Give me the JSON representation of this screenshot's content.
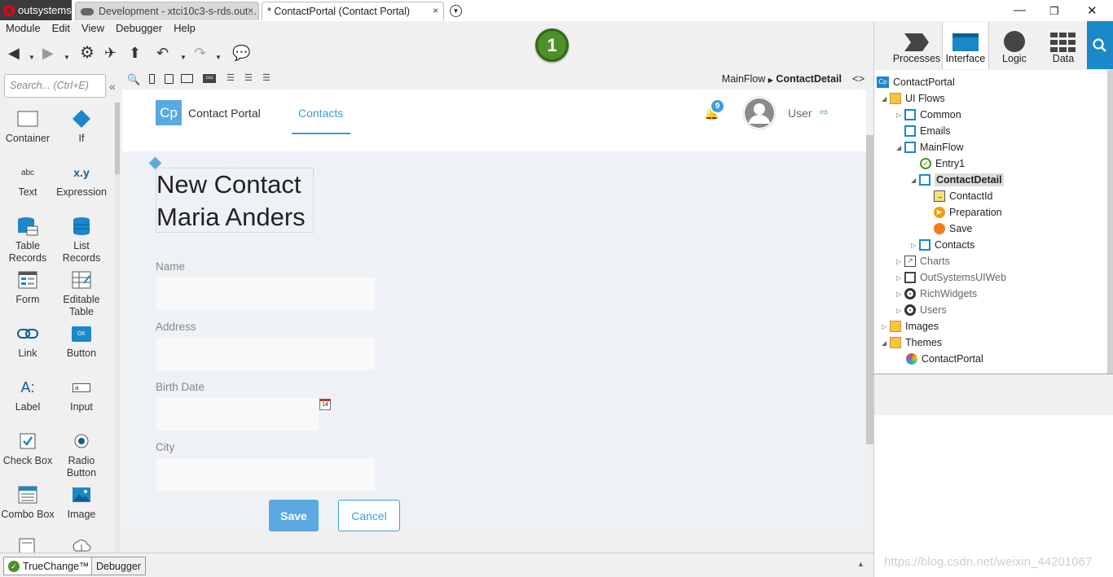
{
  "titlebar": {
    "app_name": "outsystems",
    "tabs": [
      {
        "label": "Development - xtci10c3-s-rds.out...",
        "close": "×"
      },
      {
        "label": "* ContactPortal (Contact Portal)",
        "close": "×"
      }
    ],
    "window_controls": [
      "—",
      "❐",
      "✕"
    ]
  },
  "menubar": {
    "items": [
      "Module",
      "Edit",
      "View",
      "Debugger",
      "Help"
    ]
  },
  "toolbar": {
    "step_badge": "1"
  },
  "right_tabs": [
    {
      "label": "Processes",
      "icon": "processes-icon"
    },
    {
      "label": "Interface",
      "icon": "interface-icon",
      "active": true
    },
    {
      "label": "Logic",
      "icon": "logic-icon"
    },
    {
      "label": "Data",
      "icon": "data-icon"
    }
  ],
  "widgets": {
    "search_placeholder": "Search... (Ctrl+E)",
    "items": [
      {
        "label": "Container",
        "icon": "container-icon"
      },
      {
        "label": "If",
        "icon": "if-icon"
      },
      {
        "label": "Text",
        "icon": "text-icon",
        "glyph": "abc"
      },
      {
        "label": "Expression",
        "icon": "expression-icon",
        "glyph": "x.y"
      },
      {
        "label": "Table Records",
        "icon": "table-records-icon"
      },
      {
        "label": "List Records",
        "icon": "list-records-icon"
      },
      {
        "label": "Form",
        "icon": "form-icon"
      },
      {
        "label": "Editable Table",
        "icon": "editable-table-icon"
      },
      {
        "label": "Link",
        "icon": "link-icon"
      },
      {
        "label": "Button",
        "icon": "button-icon",
        "glyph": "OK"
      },
      {
        "label": "Label",
        "icon": "label-icon",
        "glyph": "A:"
      },
      {
        "label": "Input",
        "icon": "input-icon",
        "glyph": "a"
      },
      {
        "label": "Check Box",
        "icon": "checkbox-icon"
      },
      {
        "label": "Radio Button",
        "icon": "radio-button-icon"
      },
      {
        "label": "Combo Box",
        "icon": "combo-box-icon"
      },
      {
        "label": "Image",
        "icon": "image-icon"
      }
    ]
  },
  "canvas": {
    "breadcrumb": {
      "parent": "MainFlow",
      "current": "ContactDetail"
    },
    "code_toggle": "<>",
    "app": {
      "logo": "Cp",
      "title": "Contact Portal",
      "nav_item": "Contacts",
      "notification_count": "9",
      "user_name": "User"
    },
    "heading_line1": "New Contact",
    "heading_line2": "Maria Anders",
    "fields": [
      {
        "label": "Name"
      },
      {
        "label": "Address"
      },
      {
        "label": "Birth Date",
        "calendar_glyph": "14"
      },
      {
        "label": "City"
      }
    ],
    "save_label": "Save",
    "cancel_label": "Cancel"
  },
  "tree": {
    "items": [
      {
        "label": "ContactPortal",
        "level": 0,
        "icon": "module-icon"
      },
      {
        "label": "UI Flows",
        "level": 1,
        "icon": "folder-icon",
        "toggle": "◢"
      },
      {
        "label": "Common",
        "level": 2,
        "icon": "flow-icon",
        "toggle": "▷"
      },
      {
        "label": "Emails",
        "level": 2,
        "icon": "flow-icon"
      },
      {
        "label": "MainFlow",
        "level": 2,
        "icon": "flow-icon",
        "toggle": "◢"
      },
      {
        "label": "Entry1",
        "level": 3,
        "icon": "entry-icon"
      },
      {
        "label": "ContactDetail",
        "level": 3,
        "icon": "screen-icon",
        "toggle": "◢",
        "selected": true
      },
      {
        "label": "ContactId",
        "level": 4,
        "icon": "input-parameter-icon"
      },
      {
        "label": "Preparation",
        "level": 4,
        "icon": "preparation-icon"
      },
      {
        "label": "Save",
        "level": 4,
        "icon": "action-icon"
      },
      {
        "label": "Contacts",
        "level": 3,
        "icon": "screen-icon",
        "toggle": "▷"
      },
      {
        "label": "Charts",
        "level": 2,
        "icon": "charts-icon",
        "toggle": "▷",
        "dim": true
      },
      {
        "label": "OutSystemsUIWeb",
        "level": 2,
        "icon": "flow-ref-icon",
        "toggle": "▷",
        "dim": true
      },
      {
        "label": "RichWidgets",
        "level": 2,
        "icon": "richwidgets-icon",
        "toggle": "▷",
        "dim": true
      },
      {
        "label": "Users",
        "level": 2,
        "icon": "users-icon",
        "toggle": "▷",
        "dim": true
      },
      {
        "label": "Images",
        "level": 1,
        "icon": "folder-icon",
        "toggle": "▷"
      },
      {
        "label": "Themes",
        "level": 1,
        "icon": "folder-icon",
        "toggle": "◢"
      },
      {
        "label": "ContactPortal",
        "level": 2,
        "icon": "theme-icon"
      }
    ]
  },
  "statusbar": {
    "truechange_label": "TrueChange™",
    "debugger_label": "Debugger",
    "watermark": "https://blog.csdn.net/weixin_44201067"
  },
  "colors": {
    "accent": "#1a88c9",
    "nav_active": "#3c9ddb",
    "save_button": "#5aa9e0",
    "step_badge": "#4e8f2a"
  }
}
